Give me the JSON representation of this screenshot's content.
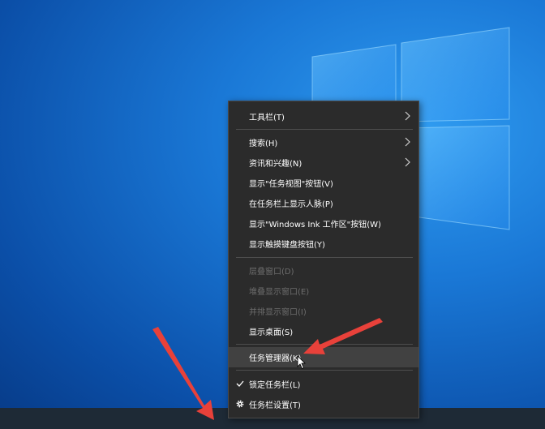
{
  "colors": {
    "menu_bg": "#2b2b2b",
    "menu_hover": "#414141",
    "menu_text": "#ffffff",
    "menu_text_disabled": "#6d6d6d",
    "separator": "#4e4e4e",
    "taskbar": "#1e2a36",
    "annotation_arrow": "#e8413a"
  },
  "menu": {
    "toolbars": "工具栏(T)",
    "search": "搜索(H)",
    "news": "资讯和兴趣(N)",
    "task_view": "显示\"任务视图\"按钮(V)",
    "people": "在任务栏上显示人脉(P)",
    "ink_workspace": "显示\"Windows Ink 工作区\"按钮(W)",
    "touch_keyboard": "显示触摸键盘按钮(Y)",
    "cascade": "层叠窗口(D)",
    "stacked": "堆叠显示窗口(E)",
    "side_by_side": "并排显示窗口(I)",
    "show_desktop": "显示桌面(S)",
    "task_manager": "任务管理器(K)",
    "lock_taskbar": "锁定任务栏(L)",
    "taskbar_settings": "任务栏设置(T)"
  },
  "icons": {
    "submenu": "chevron-right-icon",
    "check": "checkmark-icon",
    "settings": "gear-icon",
    "cursor": "mouse-pointer-icon",
    "annotation": "red-arrow-icon"
  }
}
